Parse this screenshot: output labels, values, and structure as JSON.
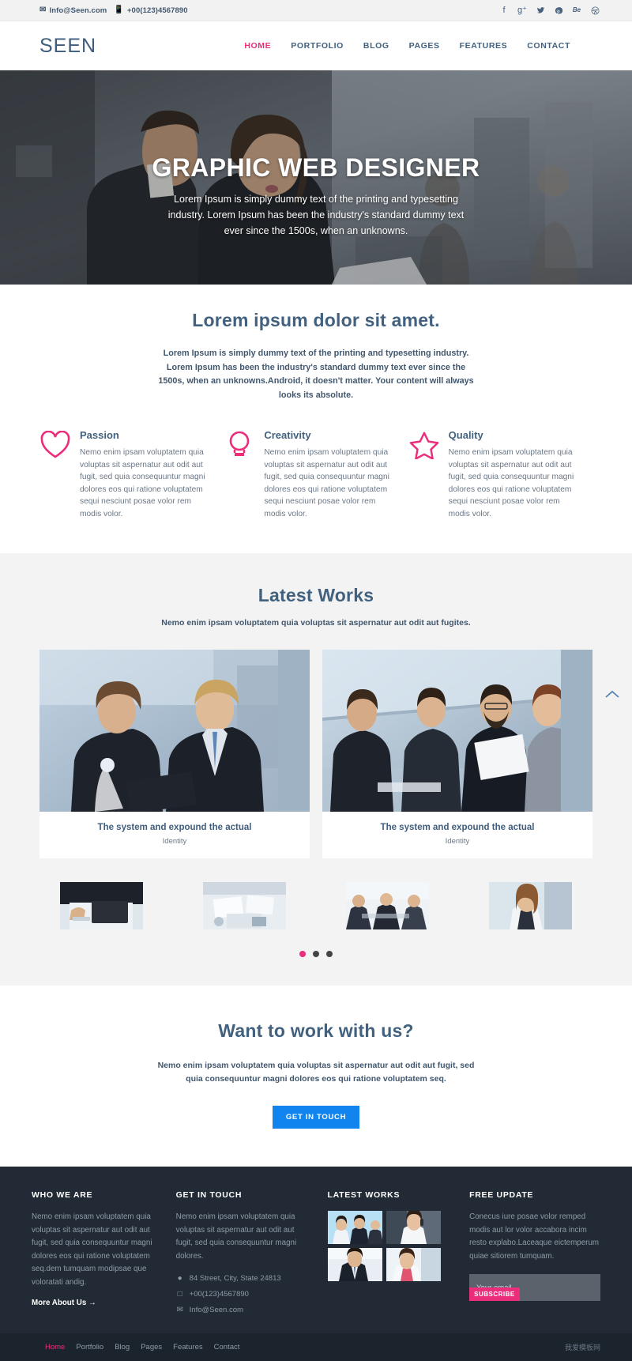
{
  "topbar": {
    "email": "Info@Seen.com",
    "phone": "+00(123)4567890",
    "email_icon": "envelope-icon",
    "phone_icon": "mobile-icon",
    "social": [
      {
        "name": "facebook-icon",
        "glyph": "f"
      },
      {
        "name": "google-plus-icon",
        "glyph": "g⁺"
      },
      {
        "name": "twitter-icon",
        "glyph": "🐦"
      },
      {
        "name": "pinterest-icon",
        "glyph": "𝑝"
      },
      {
        "name": "behance-icon",
        "glyph": "Be"
      },
      {
        "name": "dribbble-icon",
        "glyph": "⊗"
      }
    ]
  },
  "header": {
    "logo": "SEEN",
    "nav": [
      {
        "label": "HOME",
        "active": true
      },
      {
        "label": "PORTFOLIO",
        "active": false
      },
      {
        "label": "BLOG",
        "active": false
      },
      {
        "label": "PAGES",
        "active": false
      },
      {
        "label": "FEATURES",
        "active": false
      },
      {
        "label": "CONTACT",
        "active": false
      }
    ]
  },
  "hero": {
    "title": "GRAPHIC WEB DESIGNER",
    "subtitle": "Lorem Ipsum is simply dummy text of the printing and typesetting industry. Lorem Ipsum has been the industry's standard dummy text ever since the 1500s, when an unknowns."
  },
  "intro": {
    "title": "Lorem ipsum dolor sit amet.",
    "lead": "Lorem Ipsum is simply dummy text of the printing and typesetting industry. Lorem Ipsum has been the industry's standard dummy text ever since the 1500s, when an unknowns.Android, it doesn't matter. Your content will always looks its absolute.",
    "features": [
      {
        "icon": "heart-icon",
        "title": "Passion",
        "text": "Nemo enim ipsam voluptatem quia voluptas sit aspernatur aut odit aut fugit, sed quia consequuntur magni dolores eos qui ratione voluptatem sequi nesciunt posae volor rem modis volor."
      },
      {
        "icon": "lightbulb-icon",
        "title": "Creativity",
        "text": "Nemo enim ipsam voluptatem quia voluptas sit aspernatur aut odit aut fugit, sed quia consequuntur magni dolores eos qui ratione voluptatem sequi nesciunt posae volor rem modis volor."
      },
      {
        "icon": "star-icon",
        "title": "Quality",
        "text": "Nemo enim ipsam voluptatem quia voluptas sit aspernatur aut odit aut fugit, sed quia consequuntur magni dolores eos qui ratione voluptatem sequi nesciunt posae volor rem modis volor."
      }
    ]
  },
  "works": {
    "title": "Latest Works",
    "subtitle": "Nemo enim ipsam voluptatem quia voluptas sit aspernatur aut odit aut fugites.",
    "cards": [
      {
        "title": "The system and expound the actual",
        "category": "Identity"
      },
      {
        "title": "The system and expound the actual",
        "category": "Identity"
      }
    ],
    "dots": [
      {
        "active": true
      },
      {
        "active": false
      },
      {
        "active": false
      }
    ]
  },
  "cta": {
    "title": "Want to work with us?",
    "text": "Nemo enim ipsam voluptatem quia voluptas sit aspernatur aut odit aut fugit, sed quia consequuntur magni dolores eos qui ratione voluptatem seq.",
    "button": "GET IN TOUCH",
    "button_color": "#1184ef"
  },
  "footer": {
    "col1": {
      "heading": "WHO WE ARE",
      "text": "Nemo enim ipsam voluptatem quia voluptas sit aspernatur aut odit aut fugit, sed quia consequuntur magni dolores eos qui ratione voluptatem seq.dem tumquam modipsae que voloratati andig.",
      "link": "More About Us →"
    },
    "col2": {
      "heading": "GET IN TOUCH",
      "text": "Nemo enim ipsam voluptatem quia voluptas sit aspernatur aut odit aut fugit, sed quia consequuntur magni dolores.",
      "address": "84 Street, City, State 24813",
      "phone": "+00(123)4567890",
      "email": "Info@Seen.com",
      "address_icon": "map-pin-icon",
      "phone_icon": "mobile-icon",
      "email_icon": "envelope-icon"
    },
    "col3": {
      "heading": "LATEST WORKS"
    },
    "col4": {
      "heading": "FREE UPDATE",
      "text": "Conecus iure posae volor remped modis aut lor volor accabora incim resto explabo.Laceaque eictemperum quiae sitiorem tumquam.",
      "input_placeholder": "Your email...",
      "button": "SUBSCRIBE",
      "button_color": "#ec2d7c"
    },
    "bottom_nav": [
      {
        "label": "Home",
        "active": true
      },
      {
        "label": "Portfolio",
        "active": false
      },
      {
        "label": "Blog",
        "active": false
      },
      {
        "label": "Pages",
        "active": false
      },
      {
        "label": "Features",
        "active": false
      },
      {
        "label": "Contact",
        "active": false
      }
    ],
    "watermark": "我爱模板网"
  },
  "scroll_top_icon": "chevron-up-icon",
  "accent_color": "#ec2d7c",
  "heading_color": "#41617f"
}
